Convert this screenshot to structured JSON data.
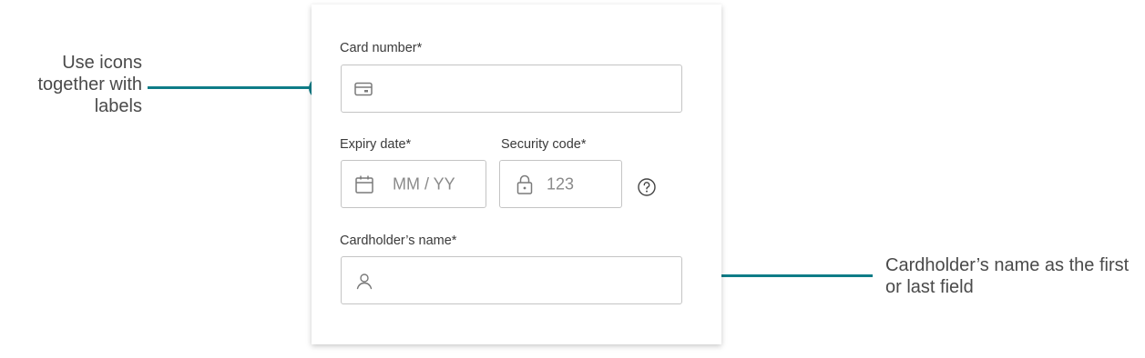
{
  "form": {
    "card_number": {
      "label": "Card number*",
      "icon": "credit-card-icon",
      "placeholder": ""
    },
    "expiry": {
      "label": "Expiry date*",
      "icon": "calendar-icon",
      "placeholder": "MM / YY"
    },
    "security": {
      "label": "Security code*",
      "icon": "lock-icon",
      "placeholder": "123",
      "help_icon": "help-circle-icon"
    },
    "cardholder": {
      "label": "Cardholder’s name*",
      "icon": "person-icon",
      "placeholder": ""
    }
  },
  "annotations": {
    "left_text": "Use icons together with labels",
    "right_text": "Cardholder’s name as the first or last field",
    "accent_color": "#0e7c87"
  }
}
